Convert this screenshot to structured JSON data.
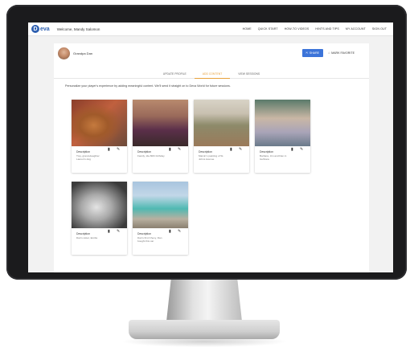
{
  "header": {
    "logo_letter": "D",
    "logo_text": "eva",
    "welcome": "Welcome, Mandy Salomon",
    "nav": [
      "HOME",
      "QUICK START",
      "HOW-TO VIDEOS",
      "HINTS AND TIPS",
      "MY ACCOUNT",
      "SIGN OUT"
    ]
  },
  "profile": {
    "name": "Grandpa Dan",
    "share_label": "SHARE",
    "favorite_label": "MARK FAVORITE"
  },
  "tabs": [
    "UPDATE PROFILE",
    "ADD CONTENT",
    "VIEW SESSIONS"
  ],
  "active_tab": "ADD CONTENT",
  "intro": "Personalize your player's experience by adding meaningful content. We'll send it straight on to Deva World for future sessions.",
  "cards": [
    {
      "title": "Description",
      "text": "Trey, grand-daughter Lauren's dog"
    },
    {
      "title": "Description",
      "text": "Family, Ida 80th birthday"
    },
    {
      "title": "Description",
      "text": "Marvin's painting of St. Johns Avenue"
    },
    {
      "title": "Description",
      "text": "Barbara, Jim and Dan in Gulfview"
    },
    {
      "title": "Description",
      "text": "Dan's sister, Emilia"
    },
    {
      "title": "Description",
      "text": "Dan's first Chevy, Dan bought this car"
    }
  ],
  "colors": {
    "accent": "#3c74d9",
    "active_tab": "#e8a13a"
  }
}
